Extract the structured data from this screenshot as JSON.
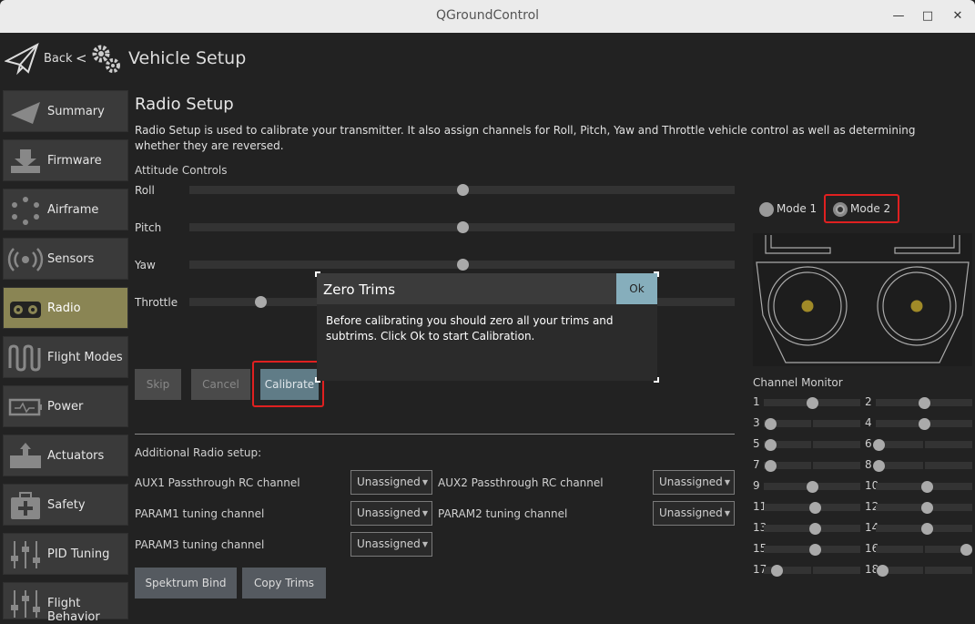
{
  "window": {
    "title": "QGroundControl",
    "minimize_icon": "minimize-icon",
    "maximize_icon": "maximize-icon",
    "close_icon": "close-icon"
  },
  "topbar": {
    "back_label": "Back",
    "separator": "<",
    "title": "Vehicle Setup"
  },
  "sidebar": {
    "items": [
      {
        "label": "Summary",
        "icon": "paper-plane-icon"
      },
      {
        "label": "Firmware",
        "icon": "download-icon"
      },
      {
        "label": "Airframe",
        "icon": "airframe-icon"
      },
      {
        "label": "Sensors",
        "icon": "sensors-icon"
      },
      {
        "label": "Radio",
        "icon": "radio-icon",
        "active": true
      },
      {
        "label": "Flight Modes",
        "icon": "flight-modes-icon"
      },
      {
        "label": "Power",
        "icon": "battery-icon"
      },
      {
        "label": "Actuators",
        "icon": "actuators-icon"
      },
      {
        "label": "Safety",
        "icon": "safety-icon"
      },
      {
        "label": "PID Tuning",
        "icon": "sliders-icon"
      },
      {
        "label": "Flight Behavior",
        "icon": "sliders-icon"
      }
    ]
  },
  "main": {
    "title": "Radio Setup",
    "description": "Radio Setup is used to calibrate your transmitter. It also assign channels for Roll, Pitch, Yaw and Throttle vehicle control as well as determining whether they are reversed.",
    "attitude_label": "Attitude Controls",
    "controls": [
      {
        "label": "Roll",
        "value": 0.5
      },
      {
        "label": "Pitch",
        "value": 0.5
      },
      {
        "label": "Yaw",
        "value": 0.5
      },
      {
        "label": "Throttle",
        "value": 0.13
      }
    ],
    "buttons": {
      "skip": "Skip",
      "cancel": "Cancel",
      "calibrate": "Calibrate"
    },
    "additional_label": "Additional Radio setup:",
    "aux": [
      {
        "label": "AUX1 Passthrough RC channel",
        "value": "Unassigned"
      },
      {
        "label": "AUX2 Passthrough RC channel",
        "value": "Unassigned"
      },
      {
        "label": "PARAM1 tuning channel",
        "value": "Unassigned"
      },
      {
        "label": "PARAM2 tuning channel",
        "value": "Unassigned"
      },
      {
        "label": "PARAM3 tuning channel",
        "value": "Unassigned"
      }
    ],
    "spektrum_bind": "Spektrum Bind",
    "copy_trims": "Copy Trims"
  },
  "modes": {
    "mode1": "Mode 1",
    "mode2": "Mode 2",
    "selected": "Mode 2"
  },
  "channel_monitor": {
    "title": "Channel Monitor",
    "channels": [
      {
        "n": "1",
        "value": 0.5
      },
      {
        "n": "2",
        "value": 0.5
      },
      {
        "n": "3",
        "value": 0.07
      },
      {
        "n": "4",
        "value": 0.5
      },
      {
        "n": "5",
        "value": 0.07
      },
      {
        "n": "6",
        "value": 0.03
      },
      {
        "n": "7",
        "value": 0.07
      },
      {
        "n": "8",
        "value": 0.03
      },
      {
        "n": "9",
        "value": 0.5
      },
      {
        "n": "10",
        "value": 0.53
      },
      {
        "n": "11",
        "value": 0.53
      },
      {
        "n": "12",
        "value": 0.53
      },
      {
        "n": "13",
        "value": 0.53
      },
      {
        "n": "14",
        "value": 0.53
      },
      {
        "n": "15",
        "value": 0.53
      },
      {
        "n": "16",
        "value": 0.93
      },
      {
        "n": "17",
        "value": 0.13
      },
      {
        "n": "18",
        "value": 0.07
      }
    ]
  },
  "dialog": {
    "title": "Zero Trims",
    "ok": "Ok",
    "text": "Before calibrating you should zero all your trims and subtrims. Click Ok to start Calibration."
  }
}
